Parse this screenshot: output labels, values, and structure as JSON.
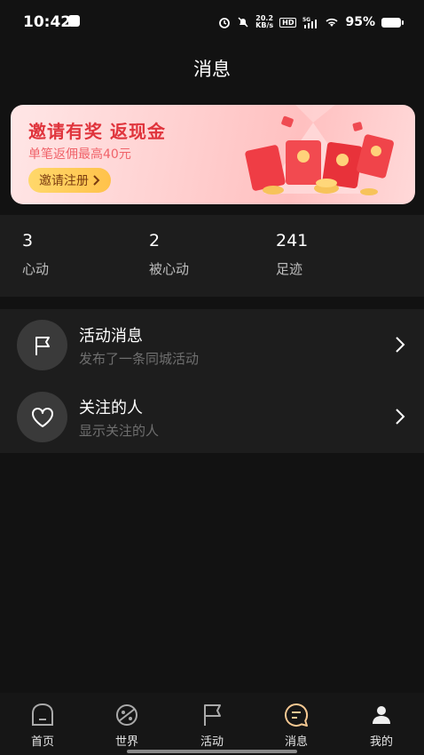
{
  "status": {
    "time": "10:42",
    "net_speed": "20.2",
    "net_unit": "KB/s",
    "hd": "HD",
    "signal": "5G",
    "battery": "95%"
  },
  "header": {
    "title": "消息"
  },
  "banner": {
    "title": "邀请有奖 返现金",
    "subtitle": "单笔返佣最高40元",
    "button": "邀请注册"
  },
  "stats": [
    {
      "count": "3",
      "label": "心动"
    },
    {
      "count": "2",
      "label": "被心动"
    },
    {
      "count": "241",
      "label": "足迹"
    }
  ],
  "list": [
    {
      "title": "活动消息",
      "subtitle": "发布了一条同城活动",
      "icon": "flag-icon"
    },
    {
      "title": "关注的人",
      "subtitle": "显示关注的人",
      "icon": "heart-icon"
    }
  ],
  "tabs": [
    {
      "label": "首页",
      "icon": "home-icon"
    },
    {
      "label": "世界",
      "icon": "planet-icon"
    },
    {
      "label": "活动",
      "icon": "flag-icon"
    },
    {
      "label": "消息",
      "icon": "message-icon",
      "active": true
    },
    {
      "label": "我的",
      "icon": "person-icon"
    }
  ],
  "colors": {
    "background": "#121212",
    "card": "#1d1d1d",
    "banner_accent": "#e0343c",
    "active_tab": "#f5c892"
  }
}
